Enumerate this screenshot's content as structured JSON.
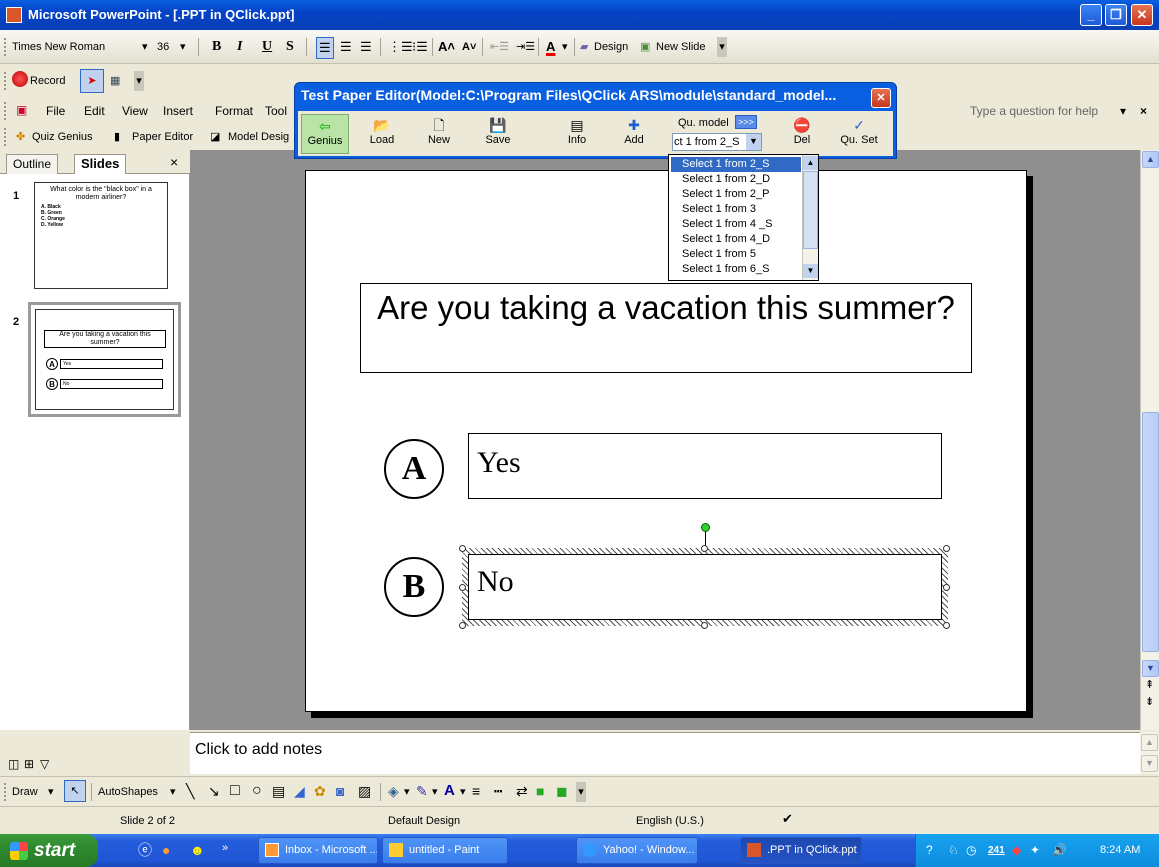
{
  "window": {
    "title": "Microsoft PowerPoint - [.PPT in QClick.ppt]",
    "min": "_",
    "restore": "❐",
    "close": "✕"
  },
  "format_toolbar": {
    "font": "Times New Roman",
    "size": "36",
    "bold": "B",
    "italic": "I",
    "underline": "U",
    "shadow": "S",
    "design": "Design",
    "new_slide": "New Slide"
  },
  "record_toolbar": {
    "record": "Record"
  },
  "menu": {
    "file": "File",
    "edit": "Edit",
    "view": "View",
    "insert": "Insert",
    "format": "Format",
    "tools": "Tool",
    "help_placeholder": "Type a question for help",
    "close_x": "×"
  },
  "qclick_toolbar": {
    "quiz_genius": "Quiz Genius",
    "paper_editor": "Paper Editor",
    "model_design": "Model Desig"
  },
  "test_paper_editor": {
    "title": "Test Paper Editor(Model:C:\\Program Files\\QClick ARS\\module\\standard_model...",
    "buttons": [
      {
        "label": "Genius",
        "icon": "⇦"
      },
      {
        "label": "Load",
        "icon": "📂"
      },
      {
        "label": "New",
        "icon": "🗋"
      },
      {
        "label": "Save",
        "icon": "💾"
      },
      {
        "label": "Info",
        "icon": "▤"
      },
      {
        "label": "Add",
        "icon": "✚"
      },
      {
        "label": "Del",
        "icon": "⛔"
      },
      {
        "label": "Qu. Set",
        "icon": "✓"
      }
    ],
    "qu_model_label": "Qu. model",
    "qu_model_more": ">>>",
    "qu_model_value": "ct 1 from 2_S",
    "dropdown_items": [
      "Select 1 from 2_S",
      "Select 1 from 2_D",
      "Select 1 from 2_P",
      "Select 1 from 3",
      "Select 1 from 4 _S",
      "Select 1 from 4_D",
      "Select 1 from 5",
      "Select 1 from 6_S"
    ]
  },
  "left_panel": {
    "tab_outline": "Outline",
    "tab_slides": "Slides",
    "close": "×",
    "slide1": {
      "num": "1",
      "question": "What color is the \"black box\" in a modern airliner?",
      "options": [
        "A. Black",
        "B. Green",
        "C. Orange",
        "D. Yellow"
      ]
    },
    "slide2": {
      "num": "2",
      "question": "Are you taking a vacation this summer?",
      "a": "A",
      "a_text": "Yes",
      "b": "B",
      "b_text": "No"
    }
  },
  "slide": {
    "question": "Are you taking a vacation this summer?",
    "a_letter": "A",
    "a_text": "Yes",
    "b_letter": "B",
    "b_text": "No"
  },
  "notes_placeholder": "Click to add notes",
  "draw_toolbar": {
    "draw": "Draw",
    "autoshapes": "AutoShapes"
  },
  "status": {
    "slide": "Slide 2 of 2",
    "design": "Default Design",
    "lang": "English (U.S.)"
  },
  "taskbar": {
    "start": "start",
    "items": [
      "Inbox - Microsoft ...",
      "untitled - Paint",
      "Yahoo! - Window...",
      ".PPT in QClick.ppt"
    ],
    "clock": "8:24 AM",
    "tray_badge": "241"
  }
}
